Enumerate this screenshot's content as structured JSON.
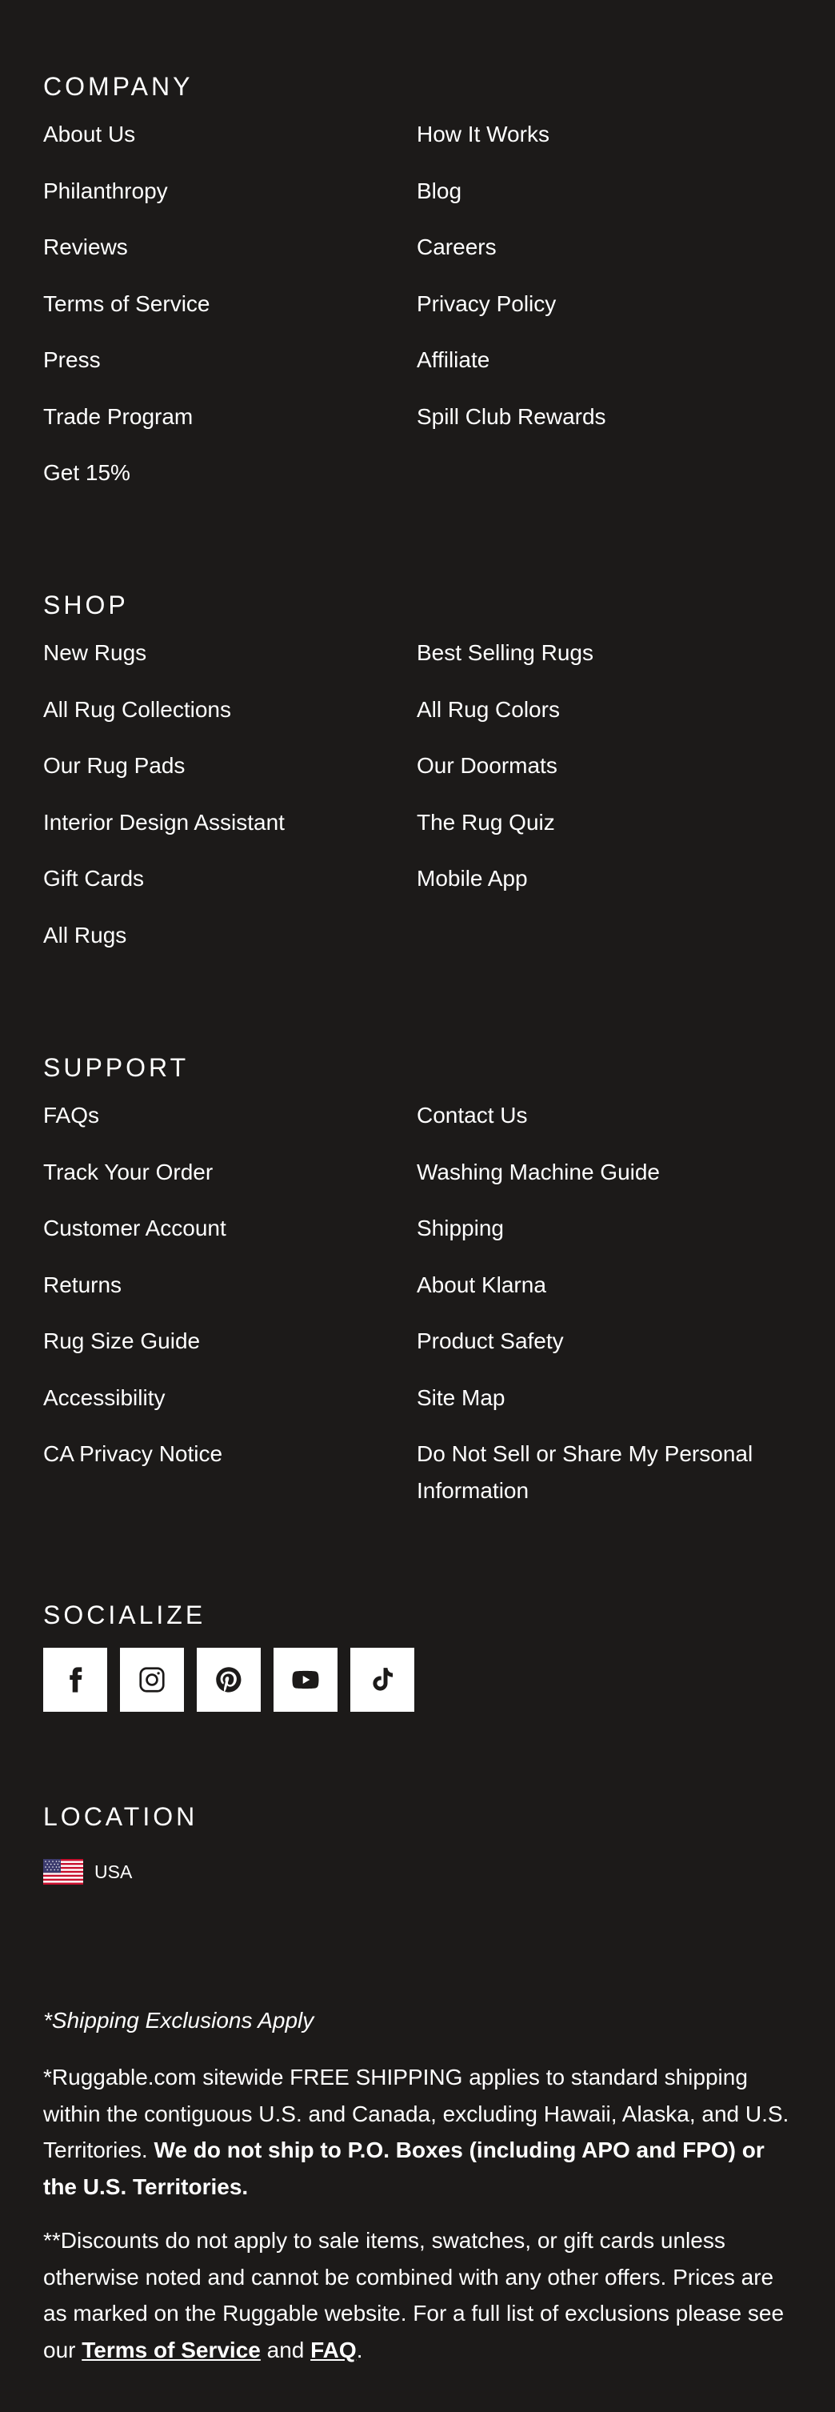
{
  "company": {
    "title": "COMPANY",
    "links": [
      "About Us",
      "How It Works",
      "Philanthropy",
      "Blog",
      "Reviews",
      "Careers",
      "Terms of Service",
      "Privacy Policy",
      "Press",
      "Affiliate",
      "Trade Program",
      "Spill Club Rewards",
      "Get 15%"
    ]
  },
  "shop": {
    "title": "SHOP",
    "links": [
      "New Rugs",
      "Best Selling Rugs",
      "All Rug Collections",
      "All Rug Colors",
      "Our Rug Pads",
      "Our Doormats",
      "Interior Design Assistant",
      "The Rug Quiz",
      "Gift Cards",
      "Mobile App",
      "All Rugs"
    ]
  },
  "support": {
    "title": "SUPPORT",
    "links": [
      "FAQs",
      "Contact Us",
      "Track Your Order",
      "Washing Machine Guide",
      "Customer Account",
      "Shipping",
      "Returns",
      "About Klarna",
      "Rug Size Guide",
      "Product Safety",
      "Accessibility",
      "Site Map",
      "CA Privacy Notice",
      "Do Not Sell or Share My Personal Information"
    ]
  },
  "socialize": {
    "title": "SOCIALIZE",
    "icons": [
      "facebook-icon",
      "instagram-icon",
      "pinterest-icon",
      "youtube-icon",
      "tiktok-icon"
    ]
  },
  "location": {
    "title": "LOCATION",
    "country": "USA",
    "flag_icon": "us-flag-icon"
  },
  "legal": {
    "shipping_heading": "*Shipping Exclusions Apply",
    "shipping_text": "*Ruggable.com sitewide FREE SHIPPING applies to standard shipping within the contiguous U.S. and Canada, excluding Hawaii, Alaska, and U.S. Territories.",
    "shipping_bold": "We do not ship to P.O. Boxes (including APO and FPO) or the U.S. Territories.",
    "discount_text": "**Discounts do not apply to sale items, swatches, or gift cards unless otherwise noted and cannot be combined with any other offers. Prices are as marked on the Ruggable website. For a full list of exclusions please see our",
    "terms_link": "Terms of Service",
    "and_text": "and",
    "faq_link": "FAQ",
    "period": "."
  }
}
